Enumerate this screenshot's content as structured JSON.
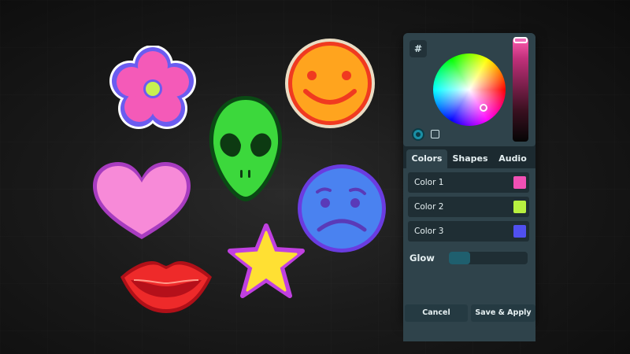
{
  "stickers": [
    {
      "name": "flower-sticker"
    },
    {
      "name": "smiley-sticker"
    },
    {
      "name": "alien-sticker"
    },
    {
      "name": "heart-sticker"
    },
    {
      "name": "sad-face-sticker"
    },
    {
      "name": "lips-sticker"
    },
    {
      "name": "star-sticker"
    }
  ],
  "picker": {
    "hex_label": "#",
    "selected_color": "#e860c8",
    "brightness_top_color": "#ff5cb0",
    "mode": "circle"
  },
  "tabs": [
    {
      "label": "Colors",
      "active": true
    },
    {
      "label": "Shapes",
      "active": false
    },
    {
      "label": "Audio",
      "active": false
    }
  ],
  "colors": [
    {
      "label": "Color 1",
      "value": "#f050b4"
    },
    {
      "label": "Color 2",
      "value": "#b8f040"
    },
    {
      "label": "Color 3",
      "value": "#5050f0"
    }
  ],
  "glow": {
    "label": "Glow",
    "level": 0.27
  },
  "buttons": {
    "cancel": "Cancel",
    "save": "Save & Apply"
  }
}
